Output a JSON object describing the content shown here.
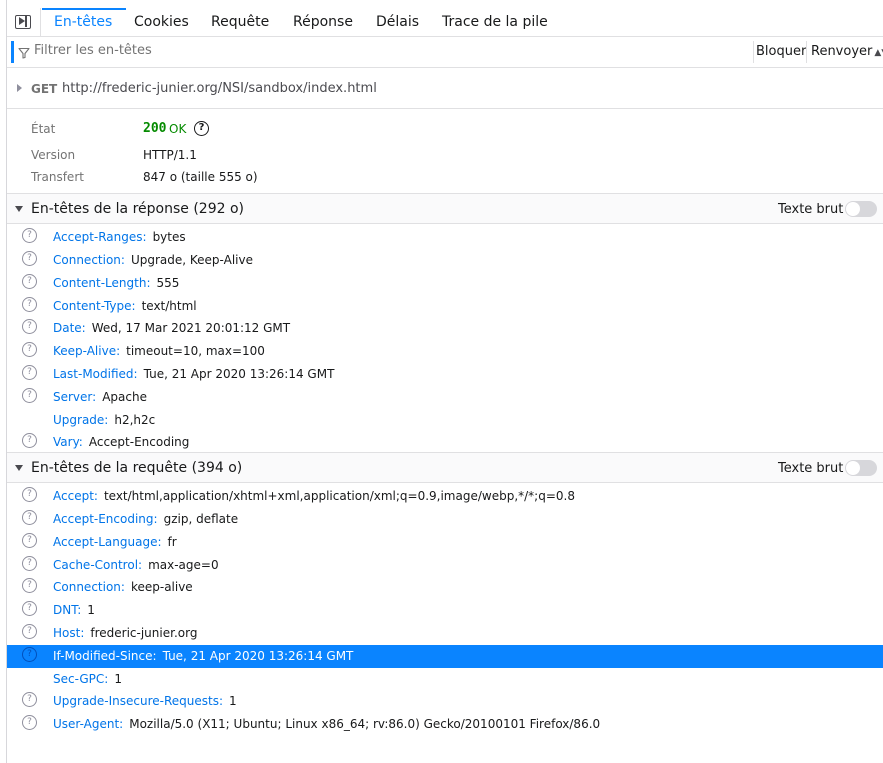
{
  "tabs": [
    {
      "label": "En-têtes",
      "active": true
    },
    {
      "label": "Cookies",
      "active": false
    },
    {
      "label": "Requête",
      "active": false
    },
    {
      "label": "Réponse",
      "active": false
    },
    {
      "label": "Délais",
      "active": false
    },
    {
      "label": "Trace de la pile",
      "active": false
    }
  ],
  "filter": {
    "placeholder": "Filtrer les en-têtes",
    "block_label": "Bloquer",
    "resend_label": "Renvoyer"
  },
  "request": {
    "method": "GET",
    "url": "http://frederic-junier.org/NSI/sandbox/index.html"
  },
  "summary": {
    "status_label": "État",
    "status_code": "200",
    "status_text": "OK",
    "version_label": "Version",
    "version_value": "HTTP/1.1",
    "transfer_label": "Transfert",
    "transfer_value": "847 o (taille 555 o)"
  },
  "response_headers": {
    "title": "En-têtes de la réponse (292 o)",
    "raw_label": "Texte brut",
    "items": [
      {
        "name": "Accept-Ranges:",
        "value": "bytes"
      },
      {
        "name": "Connection:",
        "value": "Upgrade, Keep-Alive"
      },
      {
        "name": "Content-Length:",
        "value": "555"
      },
      {
        "name": "Content-Type:",
        "value": "text/html"
      },
      {
        "name": "Date:",
        "value": "Wed, 17 Mar 2021 20:01:12 GMT"
      },
      {
        "name": "Keep-Alive:",
        "value": "timeout=10, max=100"
      },
      {
        "name": "Last-Modified:",
        "value": "Tue, 21 Apr 2020 13:26:14 GMT"
      },
      {
        "name": "Server:",
        "value": "Apache"
      },
      {
        "name": "Upgrade:",
        "value": "h2,h2c"
      },
      {
        "name": "Vary:",
        "value": "Accept-Encoding"
      }
    ]
  },
  "request_headers": {
    "title": "En-têtes de la requête (394 o)",
    "raw_label": "Texte brut",
    "items": [
      {
        "name": "Accept:",
        "value": "text/html,application/xhtml+xml,application/xml;q=0.9,image/webp,*/*;q=0.8"
      },
      {
        "name": "Accept-Encoding:",
        "value": "gzip, deflate"
      },
      {
        "name": "Accept-Language:",
        "value": "fr"
      },
      {
        "name": "Cache-Control:",
        "value": "max-age=0"
      },
      {
        "name": "Connection:",
        "value": "keep-alive"
      },
      {
        "name": "DNT:",
        "value": "1"
      },
      {
        "name": "Host:",
        "value": "frederic-junier.org"
      },
      {
        "name": "If-Modified-Since:",
        "value": "Tue, 21 Apr 2020 13:26:14 GMT"
      },
      {
        "name": "Sec-GPC:",
        "value": "1"
      },
      {
        "name": "Upgrade-Insecure-Requests:",
        "value": "1"
      },
      {
        "name": "User-Agent:",
        "value": "Mozilla/5.0 (X11; Ubuntu; Linux x86_64; rv:86.0) Gecko/20100101 Firefox/86.0"
      }
    ]
  },
  "icons": {
    "help": "question-mark-circle-icon",
    "filter": "funnel-icon",
    "sidebar": "sidebar-toggle-icon"
  },
  "colors": {
    "accent": "#0a84ff",
    "header_name": "#0074e8",
    "status_ok": "#058b00"
  }
}
